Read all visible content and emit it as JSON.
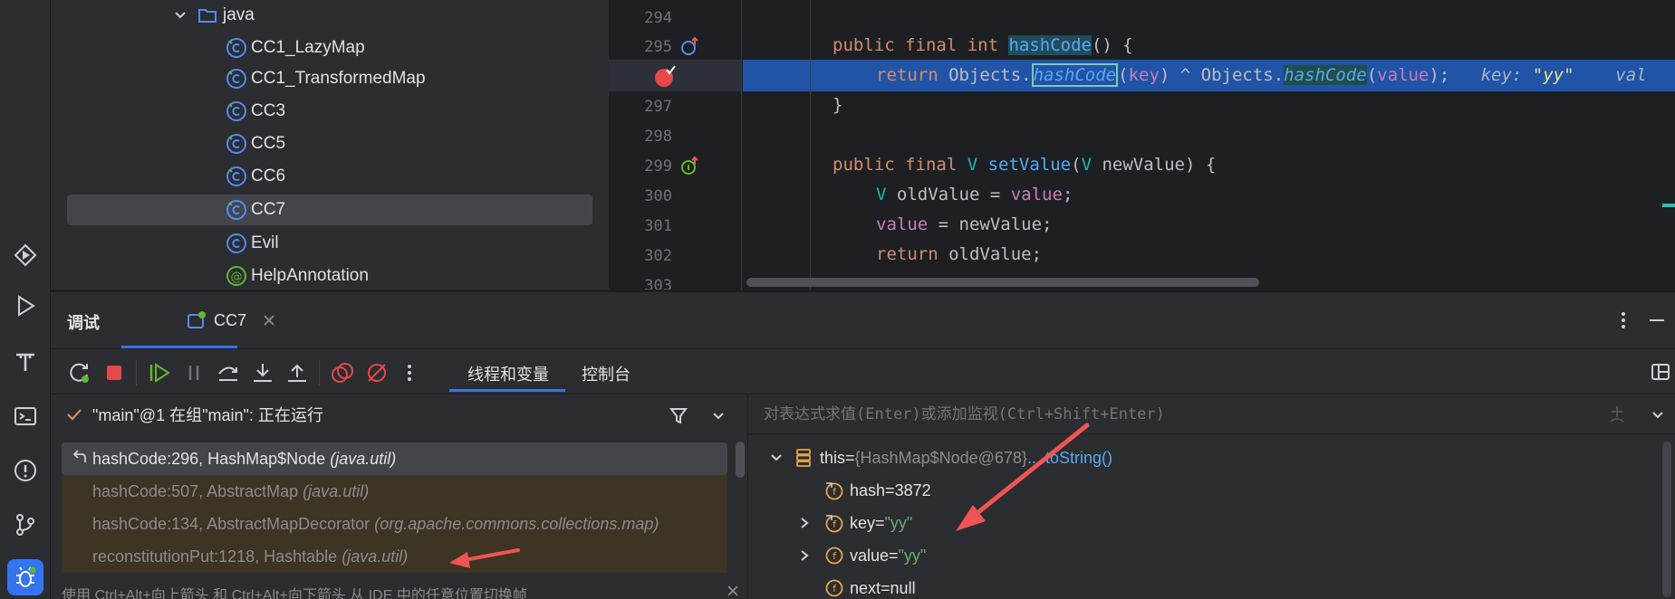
{
  "project_tree": {
    "folder": "java",
    "items": [
      "CC1_LazyMap",
      "CC1_TransformedMap",
      "CC3",
      "CC5",
      "CC6",
      "CC7",
      "Evil",
      "HelpAnnotation"
    ],
    "selected": "CC7"
  },
  "editor": {
    "line_numbers": [
      "294",
      "295",
      "",
      "297",
      "298",
      "299",
      "300",
      "301",
      "302",
      "303"
    ],
    "lines": [
      {
        "kw1": "public final int ",
        "fn": "hashCode",
        "rest": "() {"
      },
      {
        "kw": "return ",
        "obj1": "Objects.",
        "call1": "hashCode",
        "p1": "(",
        "arg1": "key",
        "mid": ") ^ Objects.",
        "call2": "hashCode",
        "p2": "(",
        "arg2": "value",
        "end": ");",
        "hint_key": "key: ",
        "hint_val": "\"yy\"",
        "hint_more": "val"
      },
      {
        "text": "}"
      },
      {
        "kw1": "public final ",
        "typ": "V ",
        "fn": "setValue",
        "p": "(",
        "typ2": "V ",
        "param": "newValue) {"
      },
      {
        "typ": "V ",
        "var": "oldValue = ",
        "fld": "value",
        "end": ";"
      },
      {
        "fld": "value",
        "rest": " = newValue;"
      },
      {
        "kw": "return ",
        "rest": "oldValue;"
      }
    ]
  },
  "debug": {
    "title": "调试",
    "tab_label": "CC7",
    "sub_tabs": [
      "线程和变量",
      "控制台"
    ],
    "thread": "\"main\"@1 在组\"main\": 正在运行",
    "frames": [
      {
        "method": "hashCode:296, HashMap$Node ",
        "pkg": "(java.util)"
      },
      {
        "method": "hashCode:507, AbstractMap ",
        "pkg": "(java.util)"
      },
      {
        "method": "hashCode:134, AbstractMapDecorator ",
        "pkg": "(org.apache.commons.collections.map)"
      },
      {
        "method": "reconstitutionPut:1218, Hashtable ",
        "pkg": "(java.util)"
      }
    ],
    "hint": "使用 Ctrl+Alt+向上箭头 和 Ctrl+Alt+向下箭头 从 IDE 中的任意位置切换帧",
    "eval_placeholder": "对表达式求值(Enter)或添加监视(Ctrl+Shift+Enter)",
    "variables": [
      {
        "name": "this",
        "eq": " = ",
        "val": "{HashMap$Node@678}",
        "link": " ... toString()"
      },
      {
        "name": "hash",
        "eq": " = ",
        "val": "3872"
      },
      {
        "name": "key",
        "eq": " = ",
        "val": "\"yy\""
      },
      {
        "name": "value",
        "eq": " = ",
        "val": "\"yy\""
      },
      {
        "name": "next",
        "eq": " = ",
        "val": "null"
      }
    ]
  },
  "colors": {
    "accent": "#3574f0",
    "annotation_arrow": "#f05454",
    "string": "#6aab73",
    "keyword": "#cf8e6d"
  }
}
